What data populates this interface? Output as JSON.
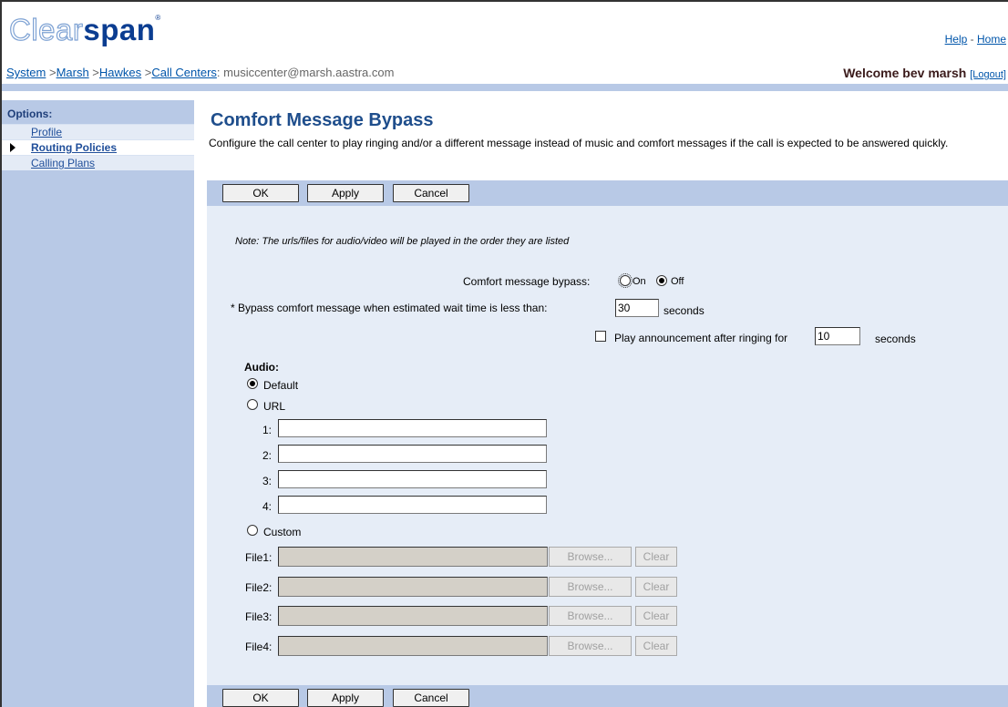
{
  "header": {
    "logo_light": "Clear",
    "logo_bold": "span",
    "logo_mark": "®",
    "links": {
      "help": "Help",
      "sep": "-",
      "home": "Home"
    },
    "breadcrumb": {
      "system": "System",
      "marsh": "Marsh",
      "hawkes": "Hawkes",
      "call_centers": "Call Centers",
      "current": ": musiccenter@marsh.aastra.com",
      "sep": " >"
    },
    "welcome": "Welcome bev marsh",
    "logout": "[Logout]"
  },
  "sidebar": {
    "title": "Options:",
    "items": [
      {
        "label": "Profile",
        "active": false
      },
      {
        "label": "Routing Policies",
        "active": true
      },
      {
        "label": "Calling Plans",
        "active": false
      }
    ]
  },
  "page": {
    "title": "Comfort Message Bypass",
    "description": "Configure the call center to play ringing and/or a different message instead of music and comfort messages if the call is expected to be answered quickly."
  },
  "buttons": {
    "ok": "OK",
    "apply": "Apply",
    "cancel": "Cancel"
  },
  "form": {
    "note": "Note: The urls/files for audio/video will be played in the order they are listed",
    "bypass_label": "Comfort message bypass:",
    "bypass_on": "On",
    "bypass_off": "Off",
    "bypass_selected": "Off",
    "wait_label": "* Bypass comfort message when estimated wait time is less than:",
    "wait_value": "30",
    "wait_unit": "seconds",
    "ring_label": "Play announcement after ringing for",
    "ring_value": "10",
    "ring_unit": "seconds",
    "ring_checked": false,
    "audio_label": "Audio:",
    "audio_default": "Default",
    "audio_url": "URL",
    "audio_custom": "Custom",
    "audio_selected": "Default",
    "urls": [
      {
        "label": "1:",
        "value": ""
      },
      {
        "label": "2:",
        "value": ""
      },
      {
        "label": "3:",
        "value": ""
      },
      {
        "label": "4:",
        "value": ""
      }
    ],
    "files": [
      {
        "label": "File1:"
      },
      {
        "label": "File2:"
      },
      {
        "label": "File3:"
      },
      {
        "label": "File4:"
      }
    ],
    "browse": "Browse...",
    "clear": "Clear"
  }
}
